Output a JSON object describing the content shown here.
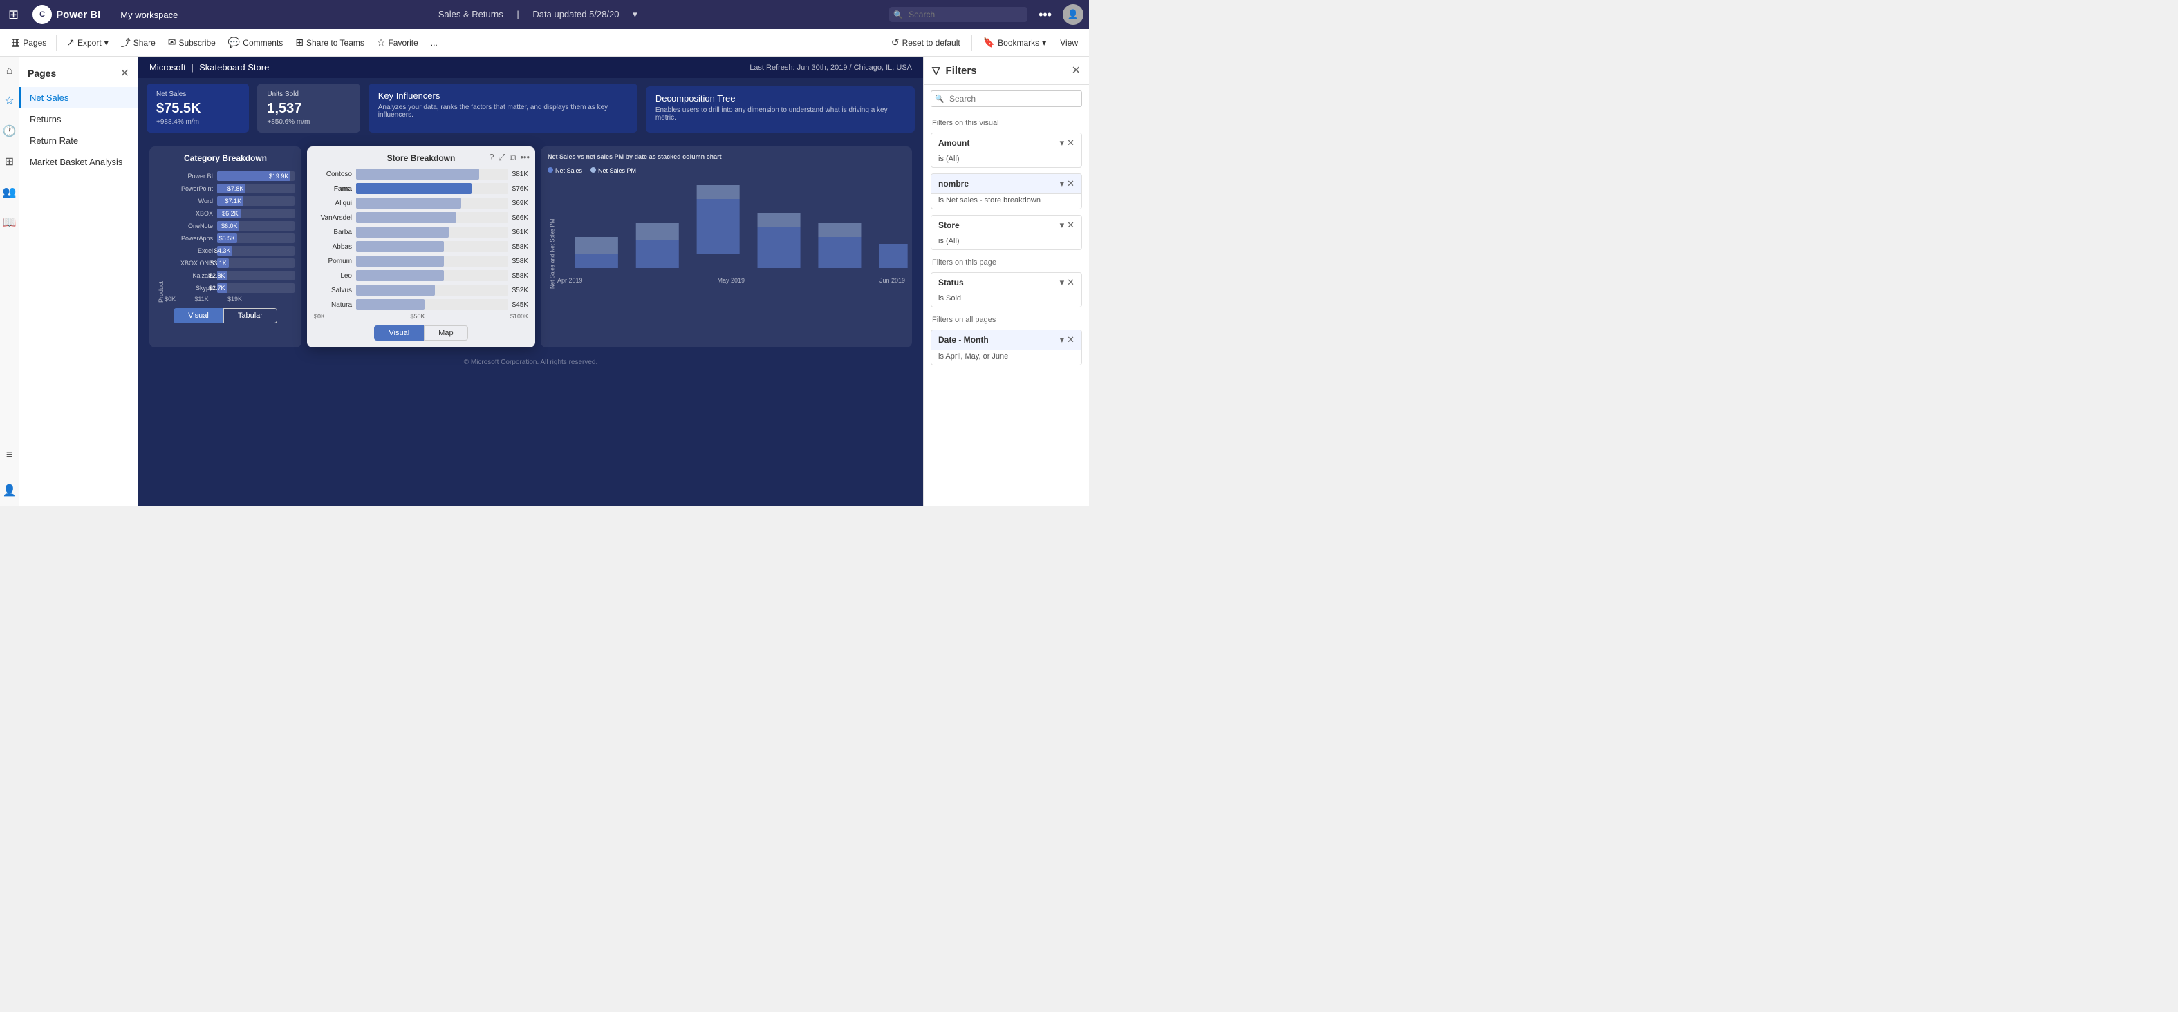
{
  "app": {
    "name": "Power BI",
    "workspace": "My workspace",
    "logo_initials": "C"
  },
  "header": {
    "title": "Sales & Returns",
    "subtitle": "Data updated 5/28/20",
    "search_placeholder": "Search"
  },
  "toolbar": {
    "pages_label": "Pages",
    "export_label": "Export",
    "share_label": "Share",
    "subscribe_label": "Subscribe",
    "comments_label": "Comments",
    "share_teams_label": "Share to Teams",
    "favorite_label": "Favorite",
    "more_label": "...",
    "reset_label": "Reset to default",
    "bookmarks_label": "Bookmarks",
    "view_label": "View"
  },
  "pages": {
    "title": "Pages",
    "items": [
      {
        "label": "Net Sales",
        "active": true
      },
      {
        "label": "Returns",
        "active": false
      },
      {
        "label": "Return Rate",
        "active": false
      },
      {
        "label": "Market Basket Analysis",
        "active": false
      }
    ]
  },
  "canvas": {
    "breadcrumb_1": "Microsoft",
    "breadcrumb_2": "Skateboard Store",
    "last_refresh": "Last Refresh: Jun 30th, 2019 / Chicago, IL, USA"
  },
  "kpi_cards": [
    {
      "label": "Net Sales",
      "value": "$75.5K",
      "change": "+988.4%",
      "change_sub": "m/m"
    },
    {
      "label": "Units Sold",
      "value": "1,537",
      "change": "+850.6%",
      "change_sub": "m/m"
    }
  ],
  "kpi_wide": [
    {
      "title": "Key Influencers",
      "desc": "Analyzes your data, ranks the factors that matter, and displays them as key influencers."
    },
    {
      "title": "Decomposition Tree",
      "desc": "Enables users to drill into any dimension to understand what is driving a key metric."
    }
  ],
  "category_chart": {
    "title": "Category Breakdown",
    "tab1": "Visual",
    "tab2": "Tabular",
    "y_axis": "Product",
    "bars": [
      {
        "label": "Power BI",
        "value": "$19.9K",
        "pct": 95
      },
      {
        "label": "PowerPoint",
        "value": "$7.8K",
        "pct": 37
      },
      {
        "label": "Word",
        "value": "$7.1K",
        "pct": 34
      },
      {
        "label": "XBOX",
        "value": "$6.2K",
        "pct": 30
      },
      {
        "label": "OneNote",
        "value": "$6.0K",
        "pct": 29
      },
      {
        "label": "PowerApps",
        "value": "$5.5K",
        "pct": 26
      },
      {
        "label": "Excel",
        "value": "$4.3K",
        "pct": 20
      },
      {
        "label": "XBOX ONE",
        "value": "$3.1K",
        "pct": 15
      },
      {
        "label": "Kaizala",
        "value": "$2.8K",
        "pct": 13
      },
      {
        "label": "Skype",
        "value": "$2.7K",
        "pct": 13
      }
    ],
    "x_labels": [
      "$0K",
      "$11K",
      "$19K"
    ]
  },
  "store_chart": {
    "title": "Store Breakdown",
    "tab1": "Visual",
    "tab2": "Map",
    "bars": [
      {
        "label": "Contoso",
        "value": "$81K",
        "pct": 81,
        "highlight": false
      },
      {
        "label": "Fama",
        "value": "$76K",
        "pct": 76,
        "highlight": true
      },
      {
        "label": "Aliqui",
        "value": "$69K",
        "pct": 69,
        "highlight": false
      },
      {
        "label": "VanArsdel",
        "value": "$66K",
        "pct": 66,
        "highlight": false
      },
      {
        "label": "Barba",
        "value": "$61K",
        "pct": 61,
        "highlight": false
      },
      {
        "label": "Abbas",
        "value": "$58K",
        "pct": 58,
        "highlight": false
      },
      {
        "label": "Pomum",
        "value": "$58K",
        "pct": 58,
        "highlight": false
      },
      {
        "label": "Leo",
        "value": "$58K",
        "pct": 58,
        "highlight": false
      },
      {
        "label": "Salvus",
        "value": "$52K",
        "pct": 52,
        "highlight": false
      },
      {
        "label": "Natura",
        "value": "$45K",
        "pct": 45,
        "highlight": false
      }
    ],
    "x_labels": [
      "$0K",
      "$50K",
      "$100K"
    ]
  },
  "net_sales_chart": {
    "title": "Net Sales vs net sales PM by date as stacked column chart",
    "legend_1": "Net Sales",
    "legend_2": "Net Sales PM",
    "x_labels": [
      "Apr 2019",
      "May 2019",
      "Jun 2019"
    ],
    "y_axis_label": "Net Sales and Net Sales PM"
  },
  "filters": {
    "title": "Filters",
    "search_placeholder": "Search",
    "visual_section": "Filters on this visual",
    "page_section": "Filters on this page",
    "all_section": "Filters on all pages",
    "items": [
      {
        "name": "Amount",
        "value": "is (All)",
        "section": "visual",
        "expanded": false
      },
      {
        "name": "nombre",
        "value": "is Net sales - store breakdown",
        "section": "visual",
        "expanded": true
      },
      {
        "name": "Store",
        "value": "is (All)",
        "section": "visual",
        "expanded": false
      },
      {
        "name": "Status",
        "value": "is Sold",
        "section": "page",
        "expanded": false
      },
      {
        "name": "Date - Month",
        "value": "is April, May, or June",
        "section": "all",
        "expanded": false
      }
    ]
  }
}
